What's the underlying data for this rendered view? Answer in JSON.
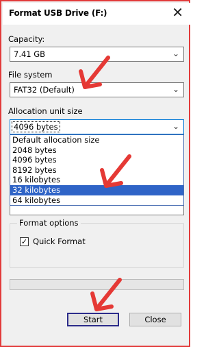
{
  "window": {
    "title": "Format USB Drive (F:)"
  },
  "capacity": {
    "label": "Capacity:",
    "value": "7.41 GB"
  },
  "file_system": {
    "label": "File system",
    "value": "FAT32 (Default)"
  },
  "allocation": {
    "label": "Allocation unit size",
    "value": "4096 bytes",
    "options": [
      "Default allocation size",
      "2048 bytes",
      "4096 bytes",
      "8192 bytes",
      "16 kilobytes",
      "32 kilobytes",
      "64 kilobytes"
    ],
    "highlighted_option": "32 kilobytes"
  },
  "format_options": {
    "title": "Format options",
    "quick_format": {
      "label": "Quick Format",
      "checked": true
    }
  },
  "progress": {
    "fraction": 0
  },
  "buttons": {
    "start": "Start",
    "close": "Close"
  },
  "annotation_color": "#e53935",
  "accent_color": "#2f64c7"
}
